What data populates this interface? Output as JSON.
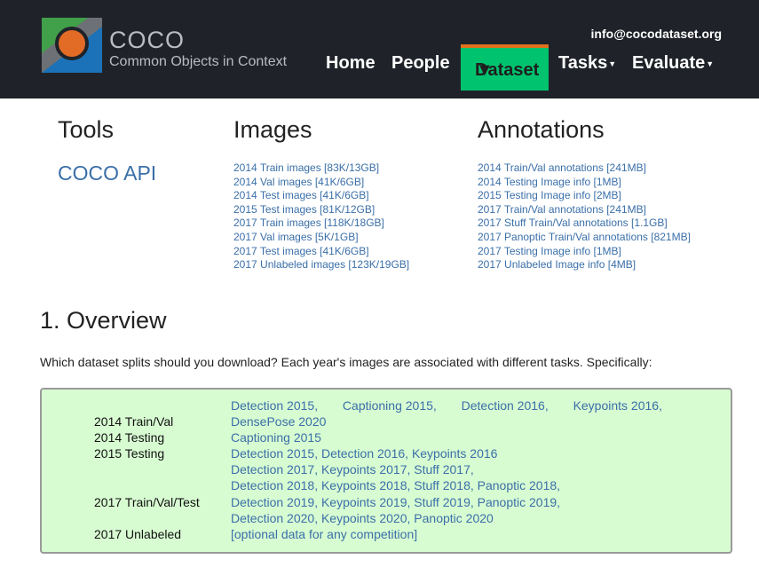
{
  "header": {
    "logo_title": "COCO",
    "logo_subtitle": "Common Objects in Context",
    "email": "info@cocodataset.org",
    "nav": {
      "home": "Home",
      "people": "People",
      "dataset": "Dataset",
      "tasks": "Tasks",
      "evaluate": "Evaluate"
    },
    "active_color": "#00c36f",
    "accent_color": "#e0711d"
  },
  "columns": {
    "tools": {
      "heading": "Tools",
      "link": "COCO API"
    },
    "images": {
      "heading": "Images",
      "links": [
        "2014 Train images [83K/13GB]",
        "2014 Val images [41K/6GB]",
        "2014 Test images [41K/6GB]",
        "2015 Test images [81K/12GB]",
        "2017 Train images [118K/18GB]",
        "2017 Val images [5K/1GB]",
        "2017 Test images [41K/6GB]",
        "2017 Unlabeled images [123K/19GB]"
      ]
    },
    "annotations": {
      "heading": "Annotations",
      "links": [
        "2014 Train/Val annotations [241MB]",
        "2014 Testing Image info [1MB]",
        "2015 Testing Image info [2MB]",
        "2017 Train/Val annotations [241MB]",
        "2017 Stuff Train/Val annotations [1.1GB]",
        "2017 Panoptic Train/Val annotations [821MB]",
        "2017 Testing Image info [1MB]",
        "2017 Unlabeled Image info [4MB]"
      ]
    }
  },
  "overview": {
    "title": "1. Overview",
    "intro": "Which dataset splits should you download? Each year's images are associated with different tasks. Specifically:",
    "rows": [
      {
        "label": "2014 Train/Val",
        "links": [
          "Detection 2015",
          "Captioning 2015",
          "Detection 2016",
          "Keypoints 2016",
          "DensePose 2020"
        ]
      },
      {
        "label": "2014 Testing",
        "links": [
          "Captioning 2015"
        ]
      },
      {
        "label": "2015 Testing",
        "links": [
          "Detection 2015",
          "Detection 2016",
          "Keypoints 2016"
        ]
      },
      {
        "label": "2017 Train/Val/Test",
        "links": [
          "Detection 2017",
          "Keypoints 2017",
          "Stuff 2017",
          "Detection 2018",
          "Keypoints 2018",
          "Stuff 2018",
          "Panoptic 2018",
          "Detection 2019",
          "Keypoints 2019",
          "Stuff 2019",
          "Panoptic 2019",
          "Detection 2020",
          "Keypoints 2020",
          "Panoptic 2020"
        ]
      },
      {
        "label": "2017 Unlabeled",
        "links": [
          "[optional data for any competition]"
        ]
      }
    ]
  }
}
